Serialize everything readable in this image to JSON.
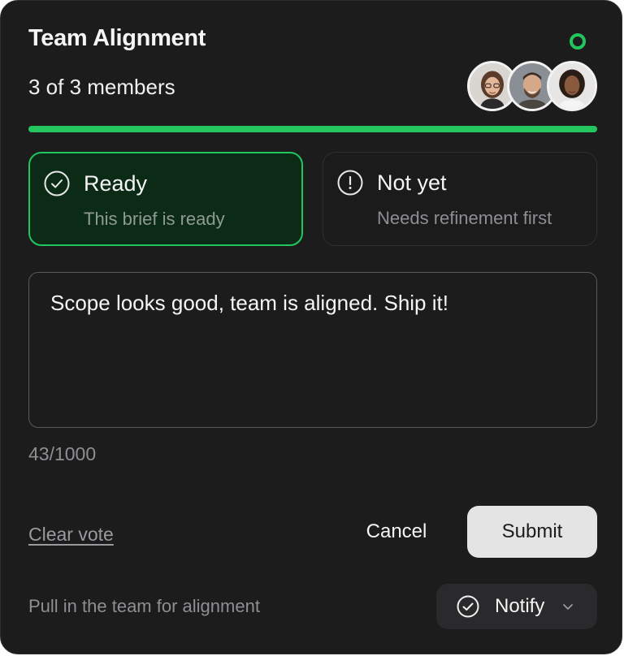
{
  "header": {
    "title": "Team Alignment",
    "members_text": "3 of 3 members",
    "status_color": "#22c55e",
    "progress_fraction": 1.0,
    "avatars": [
      {
        "icon": "avatar-woman-glasses"
      },
      {
        "icon": "avatar-man-beard"
      },
      {
        "icon": "avatar-woman-curly-hair"
      }
    ]
  },
  "options": {
    "ready": {
      "title": "Ready",
      "subtitle": "This brief is ready",
      "icon": "check-circle-icon",
      "selected": true
    },
    "not_yet": {
      "title": "Not yet",
      "subtitle": "Needs refinement first",
      "icon": "exclamation-circle-icon",
      "selected": false
    }
  },
  "comment": {
    "value": "Scope looks good, team is aligned. Ship it!",
    "counter": "43/1000"
  },
  "actions": {
    "clear_vote": "Clear vote",
    "cancel": "Cancel",
    "submit": "Submit"
  },
  "footer": {
    "text": "Pull in the team for alignment",
    "notify_label": "Notify",
    "notify_icon": "check-circle-icon",
    "dropdown_icon": "chevron-down-icon"
  },
  "colors": {
    "accent": "#22c55e",
    "background": "#1c1c1d",
    "selected_option_bg": "#0b2b16"
  }
}
